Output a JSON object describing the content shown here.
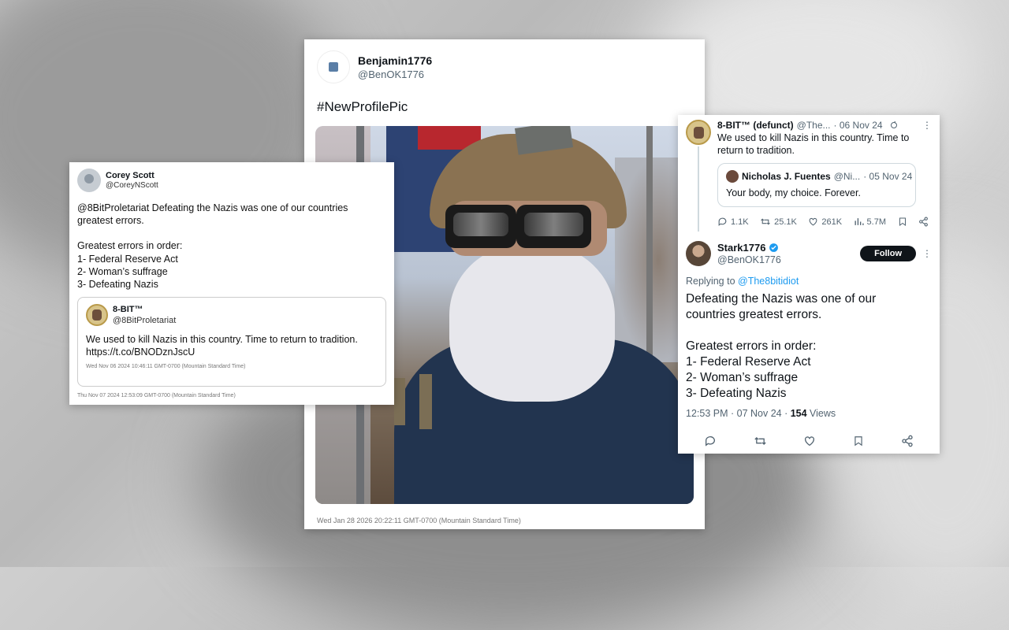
{
  "tweet_left": {
    "name": "Corey Scott",
    "handle": "@CoreyNScott",
    "body_lines": [
      "@8BitProletariat Defeating the Nazis was one of our countries",
      "greatest errors.",
      "",
      "Greatest errors in order:",
      "1- Federal Reserve Act",
      "2- Woman’s suffrage",
      "3- Defeating Nazis"
    ],
    "quote": {
      "name": "8-BIT™",
      "handle": "@8BitProletariat",
      "text": "We used to kill Nazis in this country. Time to return to tradition.",
      "link": "https://t.co/BNODznJscU",
      "timestamp": "Wed Nov 06 2024 10:46:11 GMT-0700 (Mountain Standard Time)"
    },
    "timestamp": "Thu Nov 07 2024 12:53:09 GMT-0700 (Mountain Standard Time)"
  },
  "tweet_center": {
    "name": "Benjamin1776",
    "handle": "@BenOK1776",
    "text": "#NewProfilePic",
    "timestamp": "Wed Jan 28 2026 20:22:11 GMT-0700 (Mountain Standard Time)"
  },
  "tweet_right": {
    "parent": {
      "name": "8-BIT™ (defunct)",
      "handle": "@The...",
      "date": "· 06 Nov 24",
      "text": "We used to kill Nazis in this country. Time to return to tradition.",
      "quote": {
        "name": "Nicholas J. Fuentes",
        "handle": "@Ni...",
        "date": "· 05 Nov 24",
        "text": "Your body, my choice. Forever."
      },
      "stats": {
        "replies": "1.1K",
        "retweets": "25.1K",
        "likes": "261K",
        "views": "5.7M"
      }
    },
    "reply": {
      "name": "Stark1776",
      "handle": "@BenOK1776",
      "follow_label": "Follow",
      "replying_to_prefix": "Replying to ",
      "replying_to_handle": "@The8bitidiot",
      "body_lines": [
        "Defeating the Nazis was one of our",
        "countries greatest errors.",
        "",
        "Greatest errors in order:",
        "1- Federal Reserve Act",
        "2- Woman’s suffrage",
        "3- Defeating Nazis"
      ],
      "time": "12:53 PM · 07 Nov 24 · ",
      "views_count": "154",
      "views_label": " Views"
    }
  },
  "icons": [
    "reply-icon",
    "retweet-icon",
    "like-icon",
    "views-icon",
    "bookmark-icon",
    "share-icon",
    "verified-icon",
    "more-icon",
    "edit-icon"
  ],
  "colors": {
    "link": "#1d9bf0",
    "text": "#0f1419",
    "muted": "#536471"
  }
}
